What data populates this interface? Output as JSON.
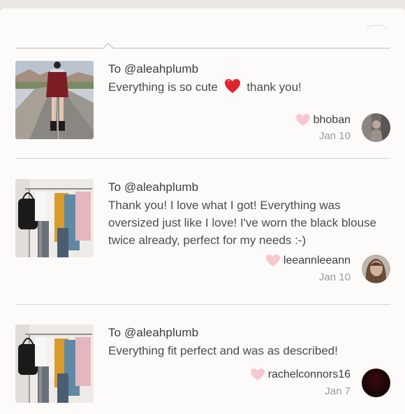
{
  "reviews": [
    {
      "to": "To @aleahplumb",
      "message_before": "Everything is so cute",
      "message_emoji": "red-heart-emoji",
      "message_after": "thank you!",
      "username": "bhoban",
      "date": "Jan 10",
      "thumb": "photo of girl in red pinafore dress on road",
      "avatar_colors": [
        "#6e6a67",
        "#b7a79a"
      ]
    },
    {
      "to": "To @aleahplumb",
      "message": "Thank you! I love what I got! Everything was oversized just like I love! I've worn the black blouse twice already, perfect for my needs :-)",
      "username": "leeannleeann",
      "date": "Jan 10",
      "thumb": "clothing rack with assorted items",
      "avatar_colors": [
        "#6a4a39",
        "#d3b29b"
      ]
    },
    {
      "to": "To @aleahplumb",
      "message": "Everything fit perfect and was as described!",
      "username": "rachelconnors16",
      "date": "Jan 7",
      "thumb": "clothing rack with assorted items",
      "avatar_colors": [
        "#100405",
        "#3a0a0e"
      ]
    }
  ],
  "colors": {
    "like_heart": "#f6c8cd",
    "emoji_heart": "#e0242d",
    "divider": "#d9d6d3"
  }
}
